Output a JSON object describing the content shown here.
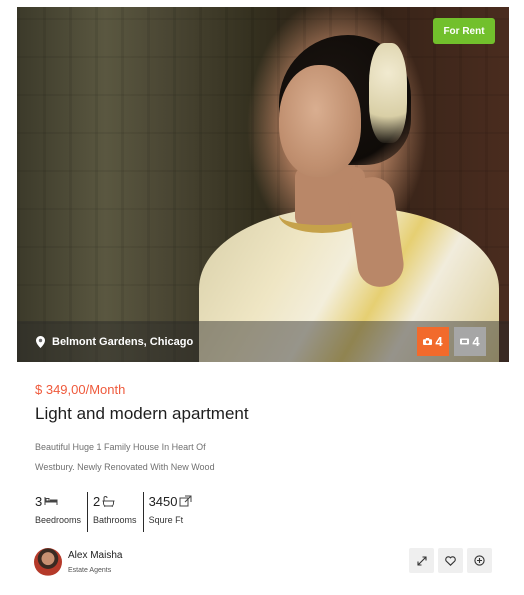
{
  "listing": {
    "badge": "For Rent",
    "location": "Belmont Gardens, Chicago",
    "photo_count": "4",
    "video_count": "4",
    "price": "$ 349,00/Month",
    "title": "Light and modern apartment",
    "description_line1": "Beautiful Huge 1 Family House In Heart Of",
    "description_line2": "Westbury. Newly Renovated With New Wood"
  },
  "features": [
    {
      "value": "3",
      "label": "Beedrooms",
      "icon": "bed-icon"
    },
    {
      "value": "2",
      "label": "Bathrooms",
      "icon": "bath-icon"
    },
    {
      "value": "3450",
      "label": "Squre Ft",
      "icon": "area-icon"
    }
  ],
  "agent": {
    "name": "Alex Maisha",
    "role": "Estate Agents"
  },
  "actions": [
    "expand-icon",
    "heart-icon",
    "plus-circle-icon"
  ],
  "colors": {
    "badge": "#72c02c",
    "price": "#ef5a3c",
    "photo_count_bg": "#f26a2c",
    "video_count_bg": "#a6a6a6"
  }
}
